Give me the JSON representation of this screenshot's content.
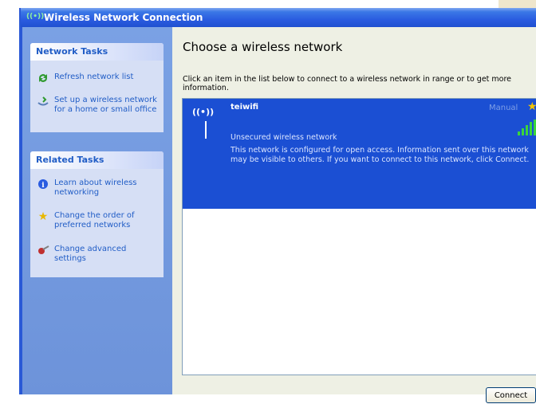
{
  "window": {
    "title": "Wireless Network Connection",
    "title_icon": "((•))"
  },
  "sidebar": {
    "network_tasks": {
      "heading": "Network Tasks",
      "items": [
        {
          "icon": "refresh-icon",
          "label": "Refresh network list"
        },
        {
          "icon": "setup-wireless-icon",
          "label": "Set up a wireless network for a home or small office"
        }
      ]
    },
    "related_tasks": {
      "heading": "Related Tasks",
      "items": [
        {
          "icon": "info-icon",
          "label": "Learn about wireless networking"
        },
        {
          "icon": "star-icon",
          "label": "Change the order of preferred networks"
        },
        {
          "icon": "settings-icon",
          "label": "Change advanced settings"
        }
      ]
    }
  },
  "main": {
    "heading": "Choose a wireless network",
    "instruction": "Click an item in the list below to connect to a wireless network in range or to get more information.",
    "networks": [
      {
        "ssid": "teiwifi",
        "connection_type": "Manual",
        "security": "Unsecured wireless network",
        "description_line1": "This network is configured for open access. Information sent over this network",
        "description_line2": "may be visible to others. If you want to connect to this network, click Connect.",
        "signal_bars": 5
      }
    ],
    "connect_label": "Connect"
  },
  "colors": {
    "titlebar": "#2a5ce0",
    "sidebar_bg": "#6d93da",
    "task_link": "#215dc6",
    "selection": "#1b4fd3",
    "signal": "#3bd43b",
    "star": "#f5c400"
  }
}
